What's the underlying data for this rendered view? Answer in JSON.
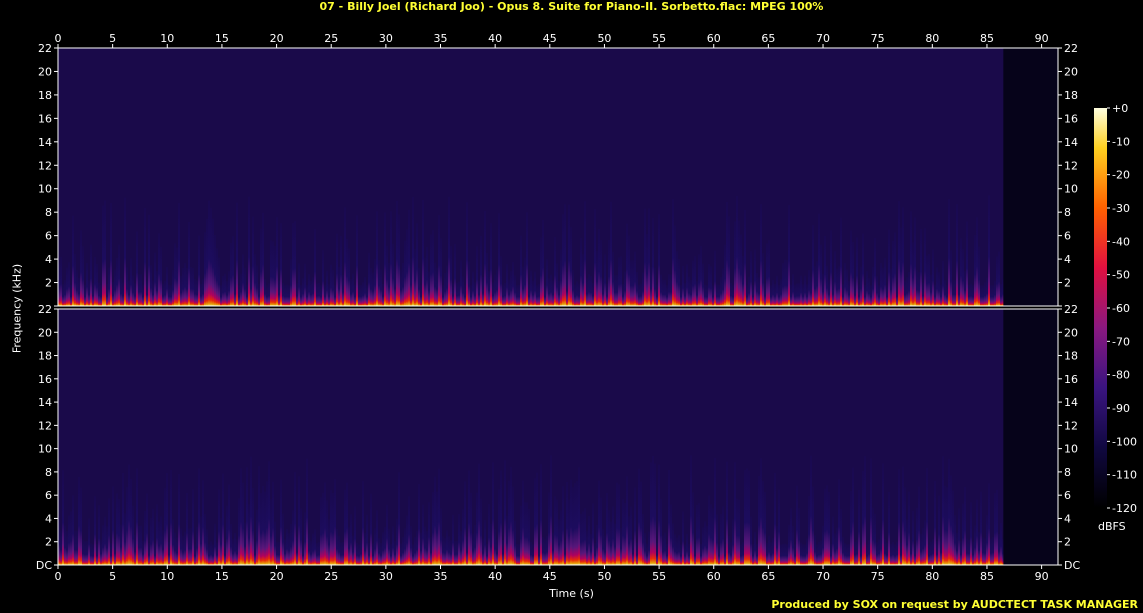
{
  "title": "07 - Billy Joel (Richard Joo) - Opus 8. Suite for Piano-II. Sorbetto.flac: MPEG 100%",
  "credit": "Produced by SOX on request by AUDCTECT TASK MANAGER",
  "colors": {
    "title": "#ffff33",
    "background": "#000000",
    "axis": "#ffffff"
  },
  "chart_data": [
    {
      "type": "heatmap",
      "channel": "top",
      "xlabel": "Time (s)",
      "ylabel": "Frequency (kHz)",
      "xlim": [
        0,
        91.5
      ],
      "ylim": [
        0,
        22
      ],
      "x_ticks": [
        0,
        5,
        10,
        15,
        20,
        25,
        30,
        35,
        40,
        45,
        50,
        55,
        60,
        65,
        70,
        75,
        80,
        85,
        90
      ],
      "y_ticks": [
        "DC",
        "2",
        "4",
        "6",
        "8",
        "10",
        "12",
        "14",
        "16",
        "18",
        "20",
        "22"
      ],
      "y_ticks_top_channel": [
        "",
        "2",
        "4",
        "6",
        "8",
        "10",
        "12",
        "14",
        "16",
        "18",
        "20",
        "22"
      ],
      "audio_end_s": 86.5
    },
    {
      "type": "heatmap",
      "channel": "bottom",
      "xlabel": "Time (s)",
      "ylabel": "Frequency (kHz)",
      "xlim": [
        0,
        91.5
      ],
      "ylim": [
        0,
        22
      ],
      "x_ticks": [
        0,
        5,
        10,
        15,
        20,
        25,
        30,
        35,
        40,
        45,
        50,
        55,
        60,
        65,
        70,
        75,
        80,
        85,
        90
      ],
      "y_ticks": [
        "DC",
        "2",
        "4",
        "6",
        "8",
        "10",
        "12",
        "14",
        "16",
        "18",
        "20",
        "22"
      ],
      "audio_end_s": 86.5
    }
  ],
  "colorbar": {
    "unit": "dBFS",
    "ticks": [
      "+0",
      "-10",
      "-20",
      "-30",
      "-40",
      "-50",
      "-60",
      "-70",
      "-80",
      "-90",
      "-100",
      "-110",
      "-120"
    ]
  }
}
